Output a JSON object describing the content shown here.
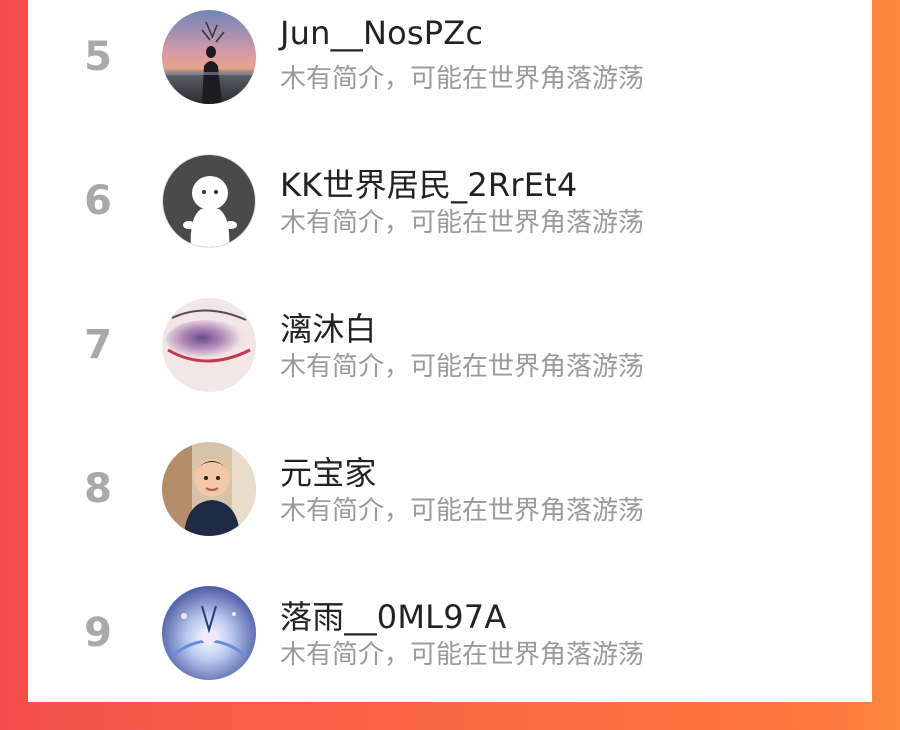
{
  "users": [
    {
      "rank": "5",
      "name": "Jun__NosPZc",
      "bio": "木有简介，可能在世界角落游荡",
      "avatar": "sunset-silhouette-avatar"
    },
    {
      "rank": "6",
      "name": "KK世界居民_2RrEt4",
      "bio": "木有简介，可能在世界角落游荡",
      "avatar": "default-ghost-avatar"
    },
    {
      "rank": "7",
      "name": "漓沐白",
      "bio": "木有简介，可能在世界角落游荡",
      "avatar": "eye-makeup-avatar"
    },
    {
      "rank": "8",
      "name": "元宝家",
      "bio": "木有简介，可能在世界角落游荡",
      "avatar": "child-photo-avatar"
    },
    {
      "rank": "9",
      "name": "落雨__0ML97A",
      "bio": "木有简介，可能在世界角落游荡",
      "avatar": "fantasy-art-avatar"
    }
  ],
  "colors": {
    "background_left": "#f24a4a",
    "background_right": "#ff8a3a",
    "rank_gray": "#a9a9a9",
    "name_text": "#222222",
    "bio_text": "#9a9a9a"
  }
}
